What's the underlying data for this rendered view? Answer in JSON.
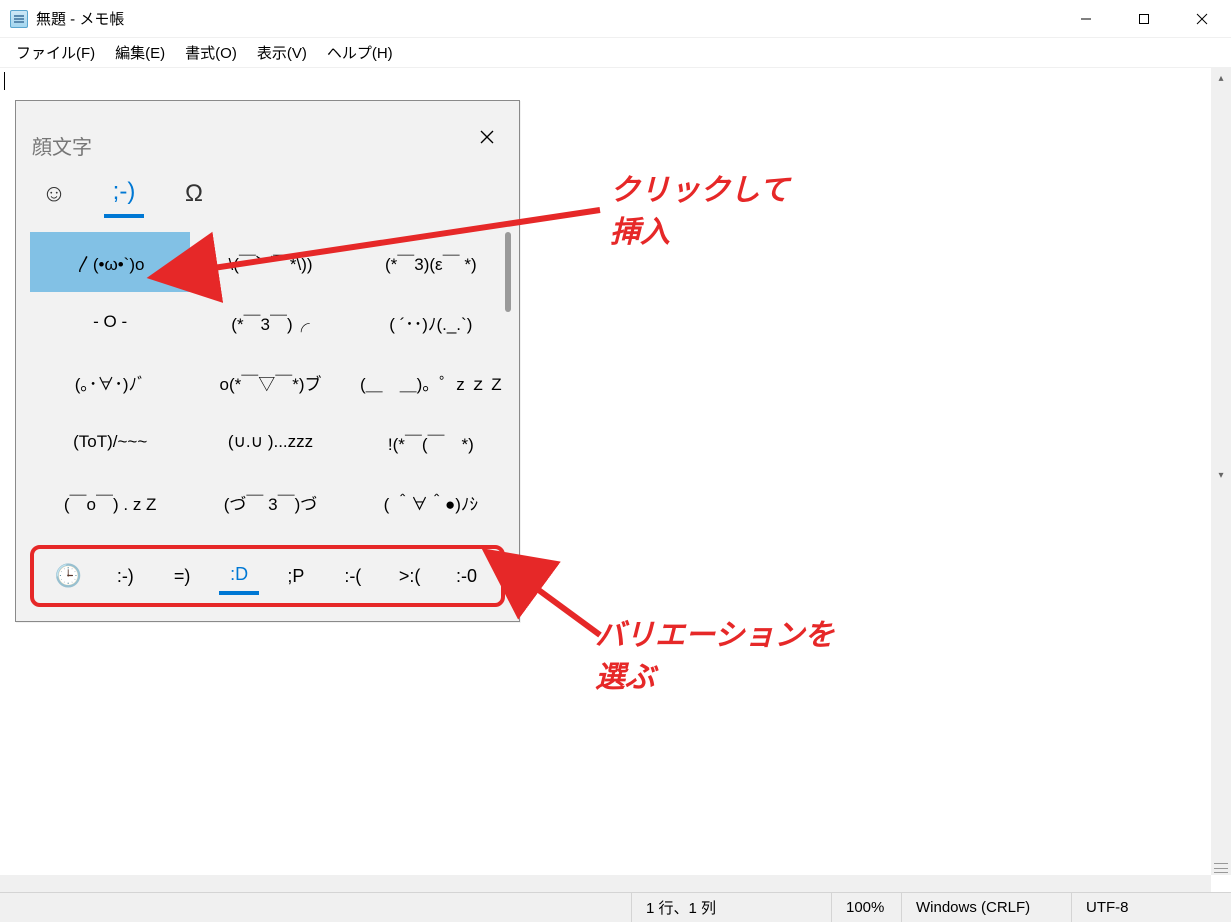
{
  "window": {
    "title": "無題 - メモ帳"
  },
  "menu": {
    "file": "ファイル(F)",
    "edit": "編集(E)",
    "format": "書式(O)",
    "view": "表示(V)",
    "help": "ヘルプ(H)"
  },
  "emoji_panel": {
    "title": "顔文字",
    "tabs": {
      "emoji": "☺",
      "kaomoji": ";-)",
      "symbols": "Ω"
    },
    "grid": [
      "〳(•ω•`)o",
      "\\(￣︶￣*\\))",
      "(*￣3)(ε￣ *)",
      "- O -",
      "(*￣3￣)╭",
      "( ´･･)ﾉ(._.`)",
      "(｡･∀･)ﾉﾞ",
      "o(*￣▽￣*)ブ",
      "(＿　＿)。゜z ｚ Z",
      "(ToT)/~~~",
      "(∪.∪ )...zzz",
      "!(*￣(￣　*)",
      "(￣o￣) . z Z",
      "(づ￣ 3￣)づ",
      "( ＾∀＾●)ﾉｼ"
    ],
    "selected_index": 0,
    "variations": {
      "clock_icon": "🕒",
      "items": [
        ":-)",
        "=)",
        ":D",
        ";P",
        ":-(",
        ">:(",
        ":-0"
      ],
      "active_index": 2
    }
  },
  "statusbar": {
    "position": "1 行、1 列",
    "zoom": "100%",
    "line_ending": "Windows (CRLF)",
    "encoding": "UTF-8"
  },
  "annotations": {
    "click_insert_line1": "クリックして",
    "click_insert_line2": "挿入",
    "variation_line1": "バリエーションを",
    "variation_line2": "選ぶ"
  }
}
